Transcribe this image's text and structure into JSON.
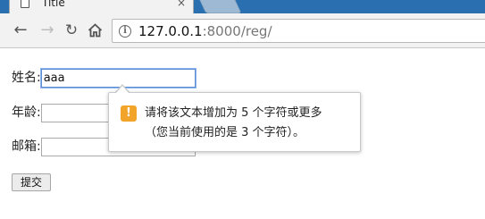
{
  "browser": {
    "tab_title": "Title",
    "tab_close": "×",
    "url_host": "127.0.0.1",
    "url_port": ":8000",
    "url_path": "/reg/"
  },
  "icons": {
    "back": "arrow-left-icon",
    "forward": "arrow-right-icon",
    "reload": "reload-icon",
    "home": "home-icon",
    "info": "info-icon",
    "warning": "warning-icon"
  },
  "form": {
    "name_label": "姓名:",
    "name_value": "aaa",
    "age_label": "年龄:",
    "age_value": "",
    "email_label": "邮箱:",
    "email_value": "",
    "submit_label": "提交"
  },
  "tooltip": {
    "icon_text": "!",
    "line1": "请将该文本增加为 5 个字符或更多",
    "line2": "（您当前使用的是 3 个字符）。"
  },
  "colors": {
    "tabstrip": "#2a6fb0",
    "warning": "#f1a32a",
    "focus": "#5a8fd6"
  }
}
